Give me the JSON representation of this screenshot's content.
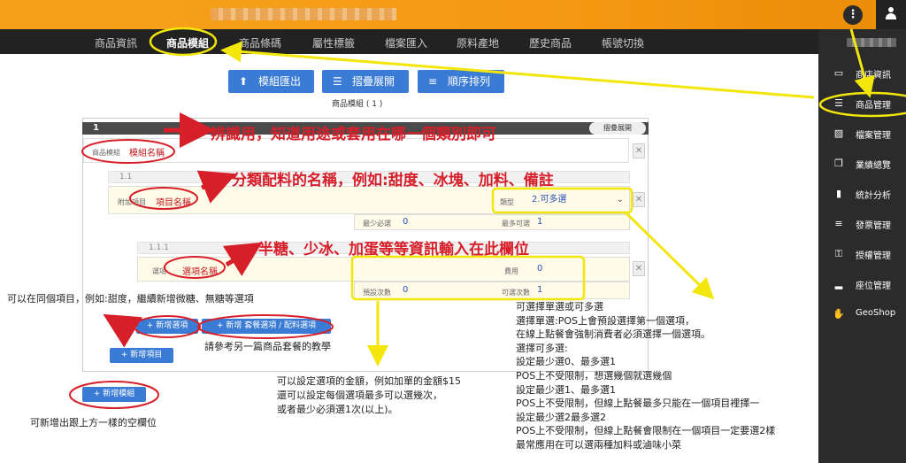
{
  "topbar": {
    "kebab": "⋮"
  },
  "tabs": [
    "商品資訊",
    "商品模組",
    "商品條碼",
    "屬性標籤",
    "檔案匯入",
    "原料產地",
    "歷史商品",
    "帳號切換"
  ],
  "sidebar": {
    "items": [
      {
        "icon": "▭",
        "label": "商店資訊"
      },
      {
        "icon": "☰",
        "label": "商品管理"
      },
      {
        "icon": "▨",
        "label": "檔案管理"
      },
      {
        "icon": "❐",
        "label": "業績總覽"
      },
      {
        "icon": "▮",
        "label": "統計分析"
      },
      {
        "icon": "≡",
        "label": "發票管理"
      },
      {
        "icon": "⚿",
        "label": "授權管理"
      },
      {
        "icon": "▂",
        "label": "座位管理"
      },
      {
        "icon": "✋",
        "label": "GeoShop"
      }
    ]
  },
  "toolbar": {
    "export": "模組匯出",
    "collapse": "摺疊展開",
    "order": "順序排列",
    "count": "商品模組 ( 1 )"
  },
  "module": {
    "index": "1",
    "collapse": "摺疊展開",
    "name_label": "商品模組",
    "name_placeholder": "模組名稱",
    "item": {
      "index": "1.1",
      "label": "附加項目",
      "name_placeholder": "項目名稱",
      "type_label": "類型",
      "type_value": "2.可多選",
      "min_label": "最少必選",
      "min_value": "0",
      "max_label": "最多可選",
      "max_value": "1",
      "option": {
        "index": "1.1.1",
        "label": "選項",
        "name_placeholder": "選項名稱",
        "price_label": "費用",
        "price_value": "0",
        "default_label": "預設次數",
        "default_value": "0",
        "max_label": "可選次數",
        "max_value": "1"
      }
    },
    "add_option": "+ 新增選項",
    "add_combo": "+ 新增 套餐選項 / 配料選項",
    "add_item": "+ 新增項目"
  },
  "add_module": "+ 新增模組",
  "annotations": {
    "a1": "辨識用，知道用途或套用在哪一個類別即可",
    "a2": "分類配料的名稱，例如:甜度、冰塊、加料、備註",
    "a3": "半糖、少冰、加蛋等等資訊輸入在此欄位",
    "n_same": "可以在同個項目，例如:甜度，繼續新增微糖、無糖等選項",
    "n_combo": "請參考另一篇商品套餐的教學",
    "n_module": "可新增出跟上方一樣的空欄位",
    "n_price": [
      "可以設定選項的金額，例如加單的金額$15",
      "還可以設定每個選項最多可以選幾次，",
      "或者最少必須選1次(以上)。"
    ],
    "n_type": [
      "可選擇單選或可多選",
      "選擇單選:POS上會預設選擇第一個選項，",
      "在線上點餐會強制消費者必須選擇一個選項。",
      "選擇可多選:",
      "設定最少選0、最多選1",
      "POS上不受限制，想選幾個就選幾個",
      "設定最少選1、最多選1",
      "POS上不受限制，但線上點餐最多只能在一個項目裡擇一",
      "設定最少選2最多選2",
      "POS上不受限制，但線上點餐會限制在一個項目一定要選2樣",
      "最常應用在可以選兩種加料或滷味小菜"
    ]
  }
}
